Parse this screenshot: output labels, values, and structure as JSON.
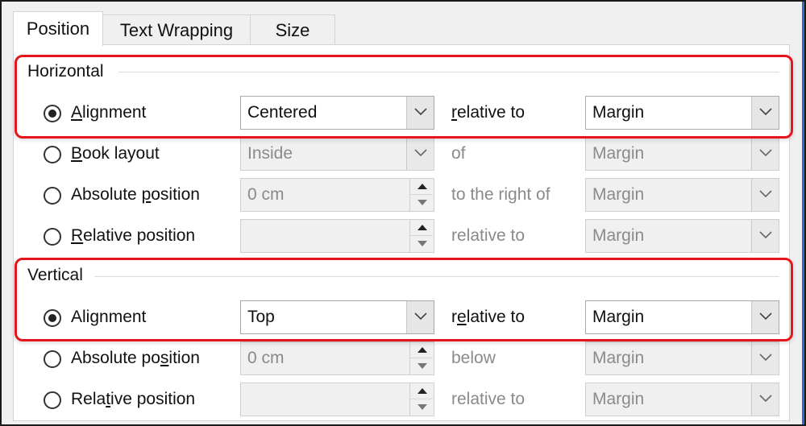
{
  "tabs": [
    {
      "label": "Position",
      "active": true
    },
    {
      "label": "Text Wrapping",
      "active": false
    },
    {
      "label": "Size",
      "active": false
    }
  ],
  "horizontal": {
    "title": "Horizontal",
    "rows": [
      {
        "option": {
          "pre": "",
          "u": "A",
          "post": "lignment"
        },
        "checked": true,
        "control": "select",
        "value": "Centered",
        "enabled": true,
        "mid_label": {
          "pre": "",
          "u": "r",
          "post": "elative to"
        },
        "target": "Margin"
      },
      {
        "option": {
          "pre": "",
          "u": "B",
          "post": "ook layout"
        },
        "checked": false,
        "control": "select",
        "value": "Inside",
        "enabled": false,
        "mid_label": {
          "pre": "of",
          "u": "",
          "post": ""
        },
        "target": "Margin"
      },
      {
        "option": {
          "pre": "Absolute ",
          "u": "p",
          "post": "osition"
        },
        "checked": false,
        "control": "spin",
        "value": "0 cm",
        "enabled": false,
        "mid_label": {
          "pre": "to the right of",
          "u": "",
          "post": ""
        },
        "target": "Margin"
      },
      {
        "option": {
          "pre": "",
          "u": "R",
          "post": "elative position"
        },
        "checked": false,
        "control": "spin",
        "value": "",
        "enabled": false,
        "mid_label": {
          "pre": "relative to",
          "u": "",
          "post": ""
        },
        "target": "Margin"
      }
    ]
  },
  "vertical": {
    "title": "Vertical",
    "rows": [
      {
        "option": {
          "pre": "Ali",
          "u": "g",
          "post": "nment"
        },
        "checked": true,
        "control": "select",
        "value": "Top",
        "enabled": true,
        "mid_label": {
          "pre": "r",
          "u": "e",
          "post": "lative to"
        },
        "target": "Margin"
      },
      {
        "option": {
          "pre": "Absolute po",
          "u": "s",
          "post": "ition"
        },
        "checked": false,
        "control": "spin",
        "value": "0 cm",
        "enabled": false,
        "mid_label": {
          "pre": "below",
          "u": "",
          "post": ""
        },
        "target": "Margin"
      },
      {
        "option": {
          "pre": "Rela",
          "u": "t",
          "post": "ive position"
        },
        "checked": false,
        "control": "spin",
        "value": "",
        "enabled": false,
        "mid_label": {
          "pre": "relative to",
          "u": "",
          "post": ""
        },
        "target": "Margin"
      }
    ]
  },
  "colors": {
    "highlight": "#e8141b",
    "accent_border": "#2b6cc4"
  }
}
